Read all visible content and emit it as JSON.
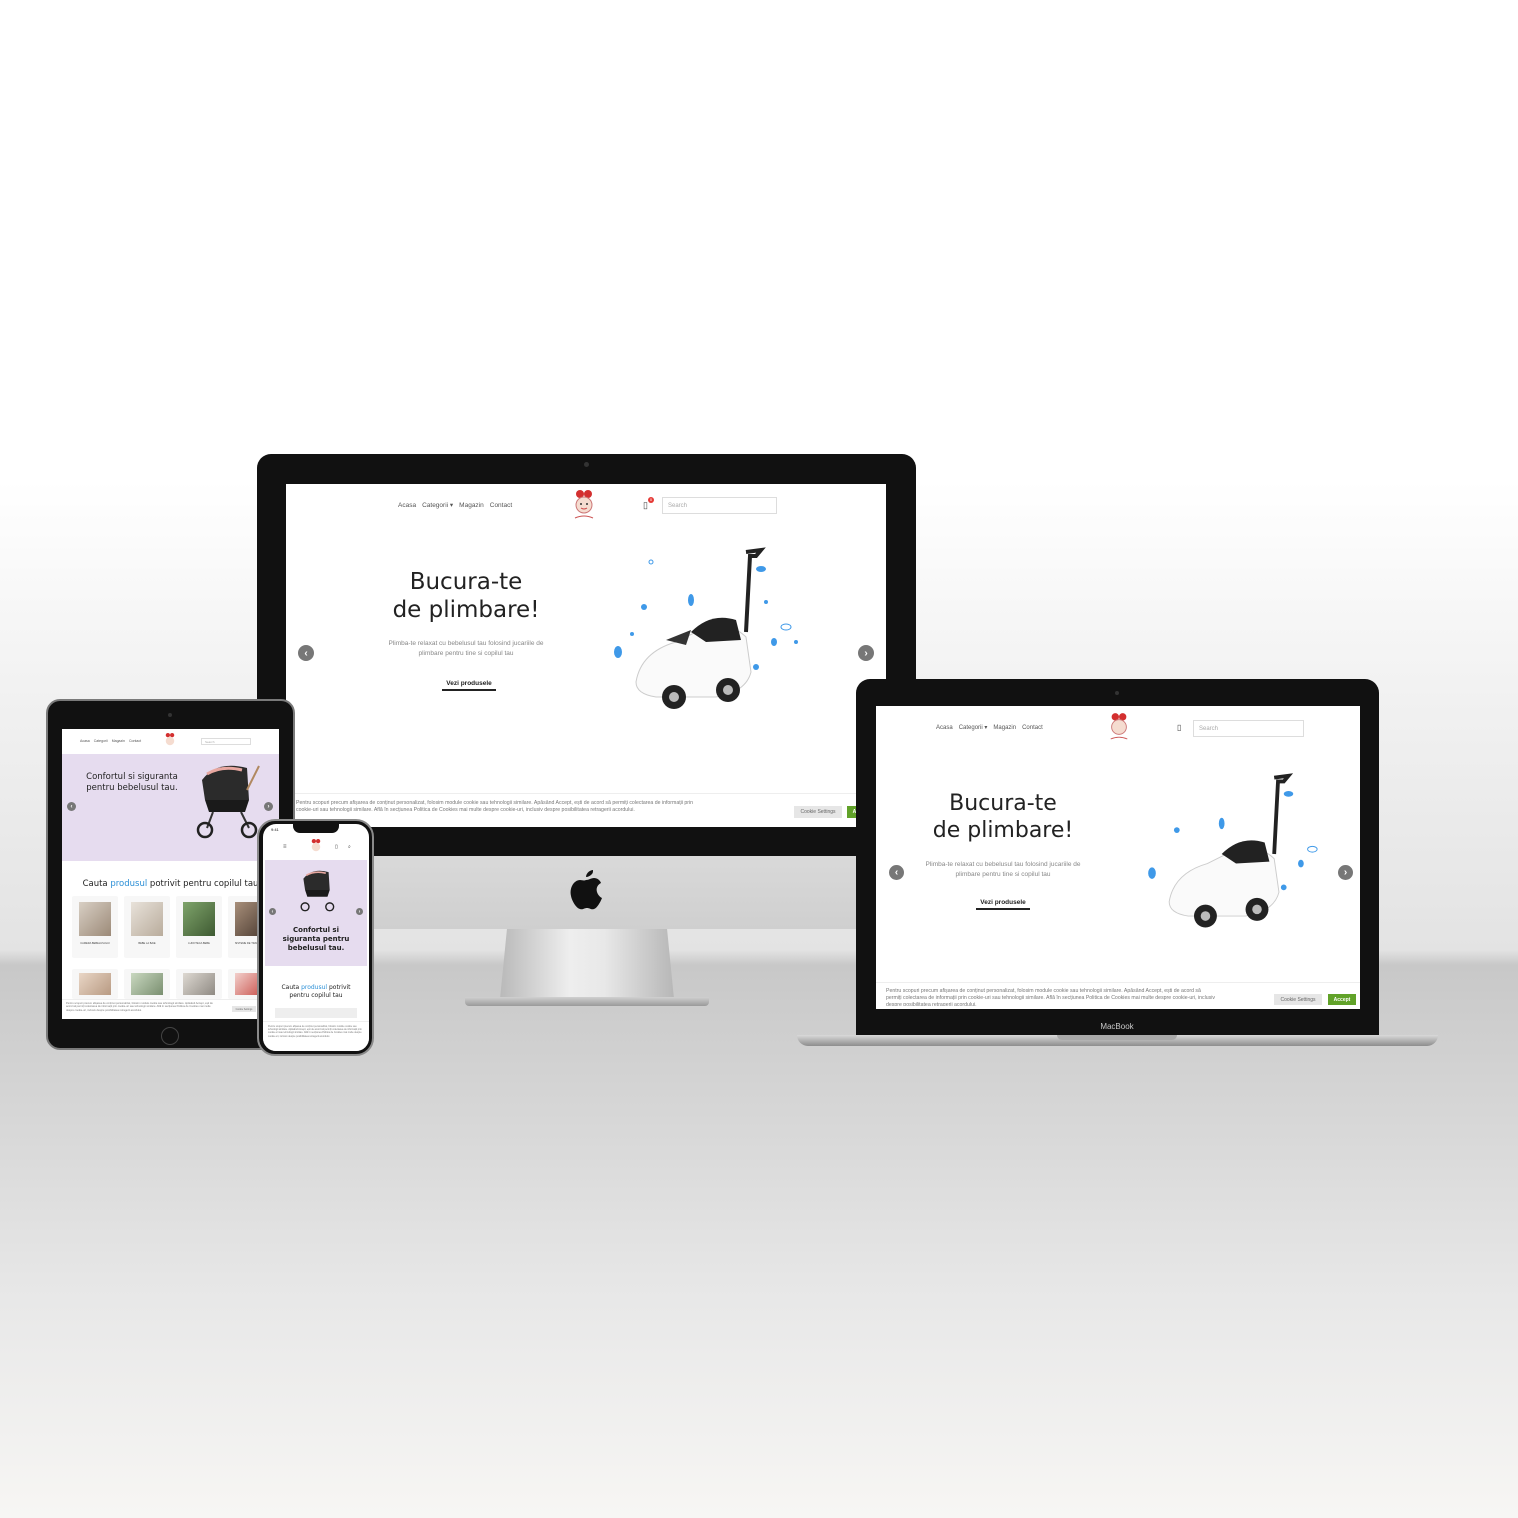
{
  "nav": {
    "home": "Acasa",
    "categories": "Categorii",
    "shop": "Magazin",
    "contact": "Contact"
  },
  "search_placeholder": "Search",
  "cart_count": "0",
  "hero": {
    "title_line1": "Bucura-te",
    "title_line2": "de plimbare!",
    "subtitle": "Plimba-te relaxat cu bebelusul tau folosind jucariile de plimbare pentru tine si copilul tau",
    "cta": "Vezi produsele"
  },
  "cookie": {
    "text": "Pentru scopuri precum afișarea de conținut personalizat, folosim module cookie sau tehnologii similare. Apăsând Accept, ești de acord să permiți colectarea de informații prin cookie-uri sau tehnologii similare. Află în secțiunea Politica de Cookies mai multe despre cookie-uri, inclusiv despre posibilitatea retragerii acordului.",
    "settings": "Cookie Settings",
    "accept": "Accept"
  },
  "tablet": {
    "hero_title": "Confortul si siguranta pentru bebelusul tau.",
    "section_title_pre": "Cauta ",
    "section_title_highlight": "produsul",
    "section_title_post": " potrivit pentru copilul tau",
    "categories": [
      "CAMERA BEBELUSULUI",
      "BEBE LA BAIE",
      "LUDOTECA BEBE",
      "SISTEME DE TRANSPORT"
    ]
  },
  "phone": {
    "time": "9:41",
    "hero_title": "Confortul si siguranta pentru bebelusul tau.",
    "section_title_pre": "Cauta ",
    "section_title_highlight": "produsul",
    "section_title_post": " potrivit pentru copilul tau"
  },
  "laptop_brand": "MacBook",
  "colors": {
    "accent": "#2b8fd6",
    "accept": "#61a229",
    "lavender": "#e6dcef",
    "cart_badge": "#e53935"
  }
}
